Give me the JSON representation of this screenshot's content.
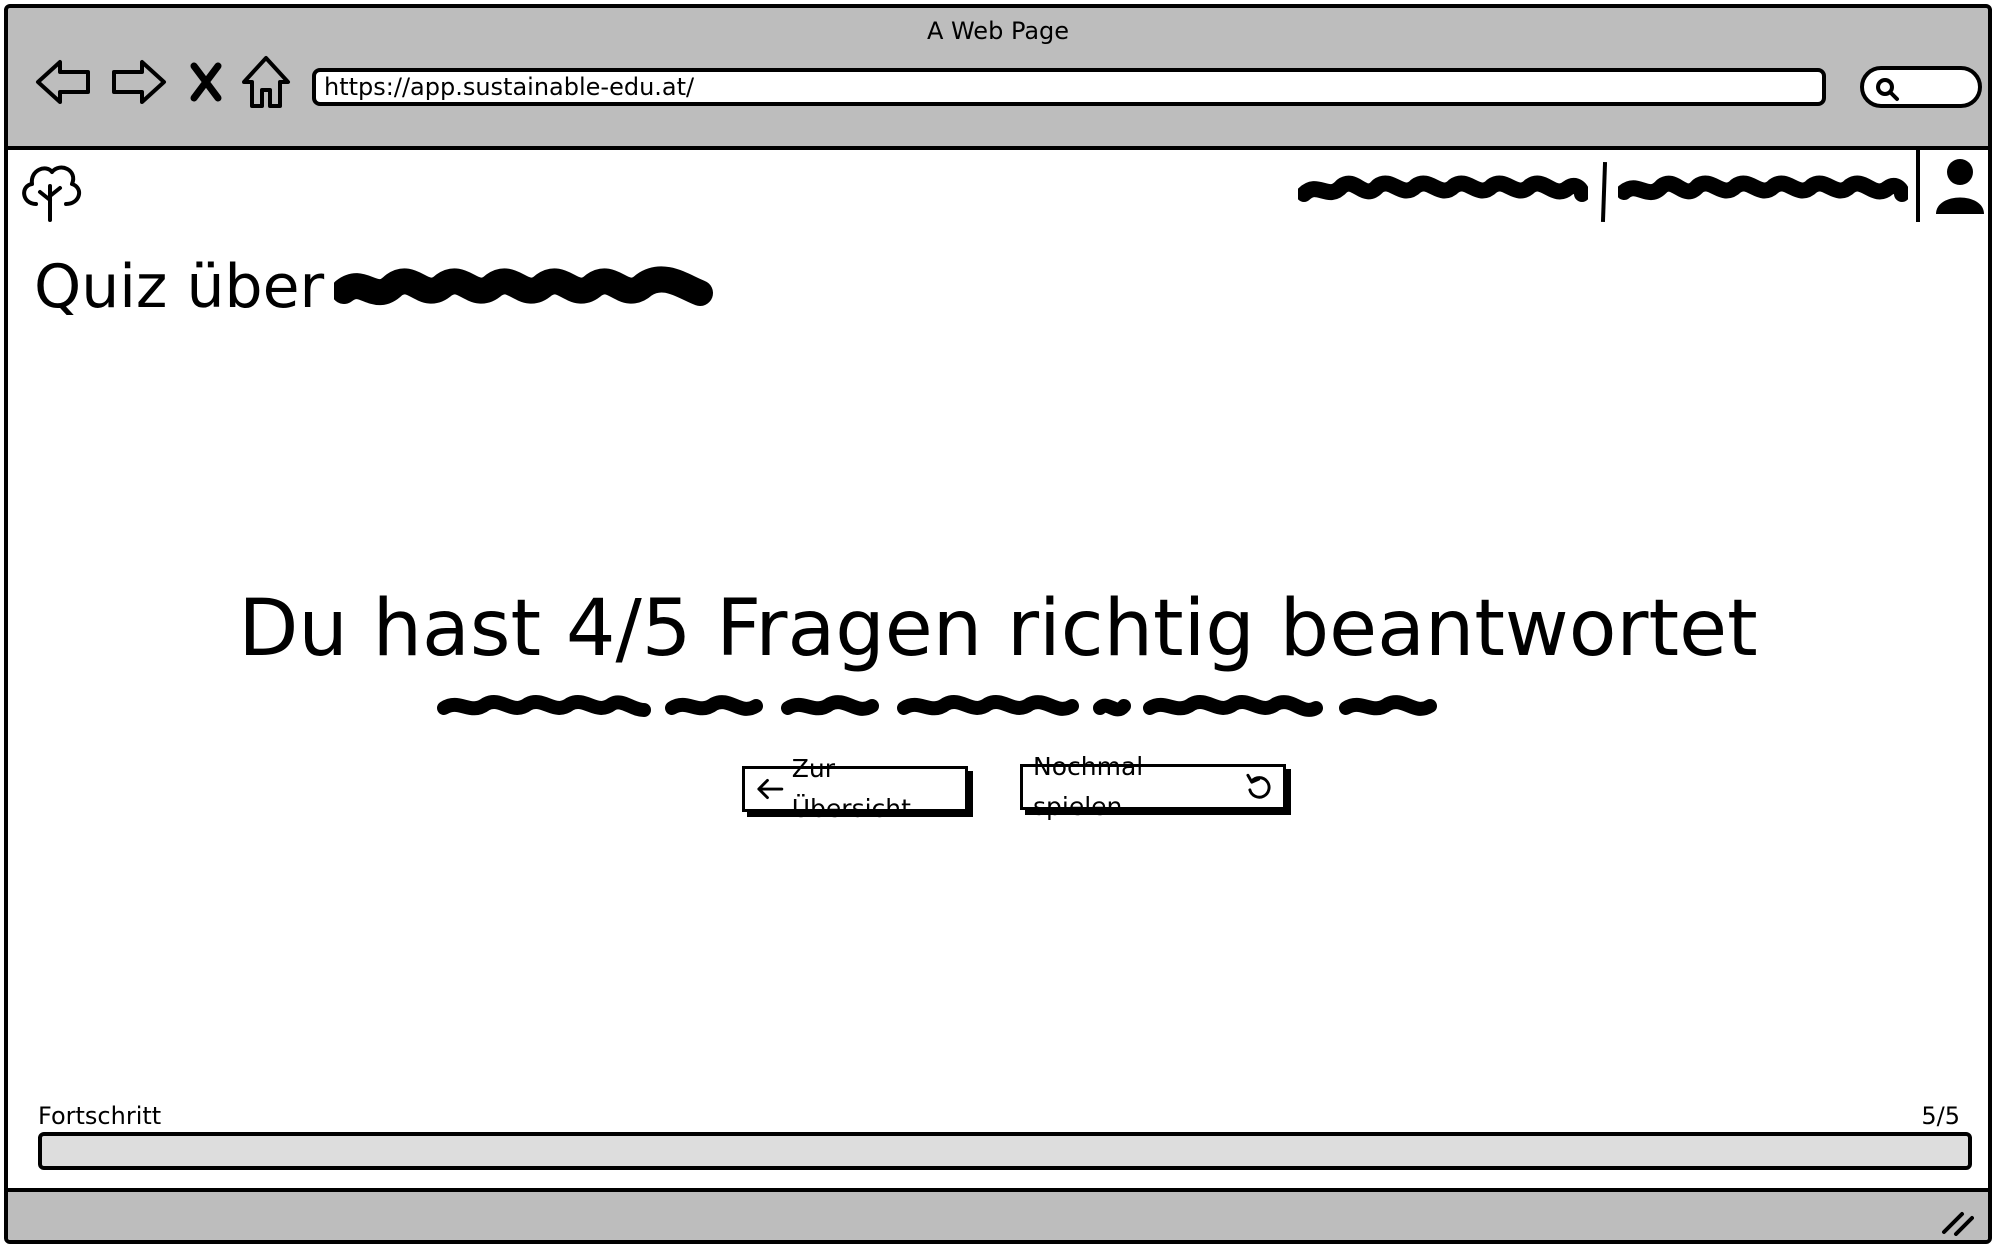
{
  "browser": {
    "window_title": "A Web Page",
    "url": "https://app.sustainable-edu.at/",
    "icons": [
      "back-arrow-icon",
      "forward-arrow-icon",
      "stop-icon",
      "home-icon",
      "search-icon"
    ]
  },
  "app": {
    "logo_icon": "tree-icon",
    "nav": [
      "redacted-nav-link-1",
      "redacted-nav-link-2"
    ],
    "user_icon": "user-icon"
  },
  "page": {
    "title_prefix": "Quiz über"
  },
  "result": {
    "heading": "Du hast 4/5 Fragen richtig beantwortet",
    "back_button": "Zur Übersicht",
    "replay_button": "Nochmal spielen"
  },
  "progress": {
    "label": "Fortschritt",
    "count": "5/5",
    "value": 0
  },
  "colors": {
    "chrome": "#bdbdbd",
    "track": "#dddddd"
  }
}
